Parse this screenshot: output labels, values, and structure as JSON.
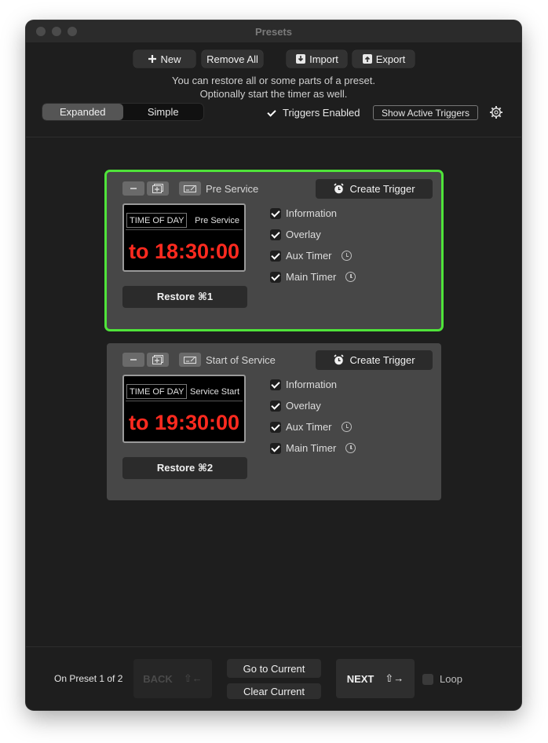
{
  "window": {
    "title": "Presets"
  },
  "toolbar": {
    "new_label": "New",
    "remove_all_label": "Remove All",
    "import_label": "Import",
    "export_label": "Export"
  },
  "hint": {
    "line1": "You can restore all or some parts of a preset.",
    "line2": "Optionally start the timer as well."
  },
  "view_mode": {
    "options": [
      "Expanded",
      "Simple"
    ],
    "selected": "Expanded"
  },
  "triggers_enabled": {
    "label": "Triggers Enabled",
    "checked": true
  },
  "show_active_triggers_label": "Show Active Triggers",
  "presets": [
    {
      "name": "Pre Service",
      "selected": true,
      "create_trigger_label": "Create Trigger",
      "preview": {
        "mode": "TIME OF DAY",
        "title": "Pre Service",
        "time": "to 18:30:00"
      },
      "restore_label": "Restore  ⌘1",
      "options": [
        {
          "label": "Information",
          "checked": true
        },
        {
          "label": "Overlay",
          "checked": true
        },
        {
          "label": "Aux Timer",
          "checked": true
        },
        {
          "label": "Main Timer",
          "checked": true
        }
      ]
    },
    {
      "name": "Start of Service",
      "selected": false,
      "create_trigger_label": "Create Trigger",
      "preview": {
        "mode": "TIME OF DAY",
        "title": "Service Start",
        "time": "to 19:30:00"
      },
      "restore_label": "Restore  ⌘2",
      "options": [
        {
          "label": "Information",
          "checked": true
        },
        {
          "label": "Overlay",
          "checked": true
        },
        {
          "label": "Aux Timer",
          "checked": true
        },
        {
          "label": "Main Timer",
          "checked": true
        }
      ]
    }
  ],
  "footer": {
    "status": "On Preset 1 of 2",
    "back_label": "BACK",
    "back_shortcut": "⇧←",
    "go_to_current_label": "Go to Current",
    "clear_current_label": "Clear Current",
    "next_label": "NEXT",
    "next_shortcut": "⇧→",
    "loop_label": "Loop",
    "loop_checked": false
  },
  "colors": {
    "selection_border": "#4fe33a",
    "timer_red": "#ff2a1f",
    "window_bg": "#1e1e1e",
    "card_bg": "#474747"
  }
}
